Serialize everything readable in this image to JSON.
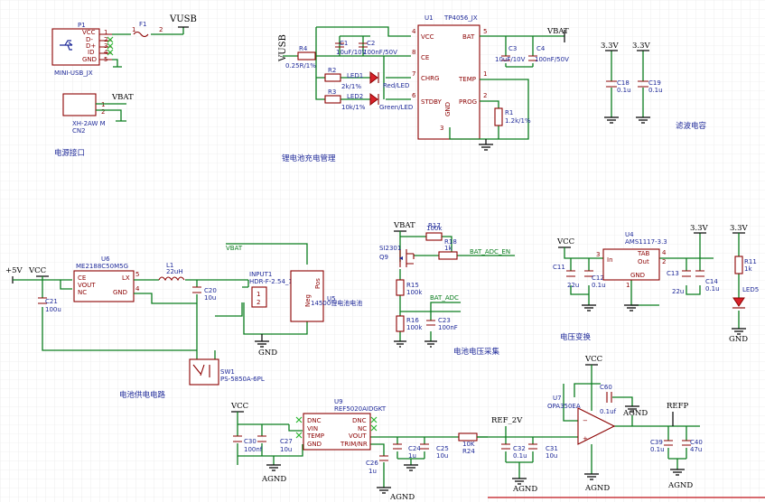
{
  "sections": {
    "power_port": "电源接口",
    "charge": "锂电池充电管理",
    "filter_cap": "滤波电容",
    "battery_supply": "电池供电电路",
    "battery_voltage_sample": "电池电压采集",
    "voltage_convert": "电压变换"
  },
  "nets": {
    "vusb": "VUSB",
    "vbat": "VBAT",
    "v33": "3.3V",
    "v5": "+5V",
    "vcc": "VCC",
    "gnd": "GND",
    "agnd": "AGND",
    "ref2v": "REF_2V",
    "refp": "REFP",
    "bat_adc_en": "BAT_ADC_EN",
    "bat_adc": "BAT_ADC"
  },
  "usb": {
    "ref": "P1",
    "part": "MINI-USB_JX",
    "pins": [
      "VCC",
      "D-",
      "D+",
      "ID",
      "GND"
    ],
    "pin_nums": [
      "1",
      "2",
      "3",
      "4",
      "5"
    ]
  },
  "fuse": {
    "ref": "F1",
    "pin1": "1",
    "pin2": "2"
  },
  "cn2": {
    "ref": "CN2",
    "part": "XH-2AW M",
    "pin1": "1",
    "pin2": "2"
  },
  "tp4056": {
    "ref": "U1",
    "part": "TP4056_JX",
    "left_pins": [
      {
        "num": "4",
        "name": "VCC"
      },
      {
        "num": "8",
        "name": "CE"
      },
      {
        "num": "7",
        "name": "CHRG"
      },
      {
        "num": "6",
        "name": "STDBY"
      }
    ],
    "right_pins": [
      {
        "num": "5",
        "name": "BAT"
      },
      {
        "num": "1",
        "name": "TEMP"
      },
      {
        "num": "2",
        "name": "PROG"
      }
    ],
    "gnd_pin": "GND",
    "gnd_num": "3"
  },
  "r4": {
    "ref": "R4",
    "value": "0.25R/1%"
  },
  "c1": {
    "ref": "C1",
    "value": "10uF/10V"
  },
  "c2": {
    "ref": "C2",
    "value": "100nF/50V"
  },
  "r2": {
    "ref": "R2",
    "value": "2k/1%"
  },
  "r3": {
    "ref": "R3",
    "value": "10k/1%"
  },
  "led1": {
    "ref": "LED1",
    "value": "Red/LED"
  },
  "led2": {
    "ref": "LED2",
    "value": "Green/LED"
  },
  "c3": {
    "ref": "C3",
    "value": "10uF/10V"
  },
  "c4": {
    "ref": "C4",
    "value": "100nF/50V"
  },
  "r1": {
    "ref": "R1",
    "value": "1.2k/1%"
  },
  "c18": {
    "ref": "C18",
    "value": "0.1u"
  },
  "c19": {
    "ref": "C19",
    "value": "0.1u"
  },
  "u6": {
    "ref": "U6",
    "part": "ME2188C50M5G",
    "left_pins": [
      "CE",
      "VOUT",
      "NC"
    ],
    "right_pins": [
      "LX",
      "GND"
    ],
    "nums": [
      "1",
      "2",
      "3",
      "5",
      "4"
    ]
  },
  "l1": {
    "ref": "L1",
    "value": "22uH"
  },
  "c20": {
    "ref": "C20",
    "value": "10u"
  },
  "c21": {
    "ref": "C21",
    "value": "100u"
  },
  "input1": {
    "ref": "INPUT1",
    "part": "HDR-F-2.54_1x2",
    "pin1": "1",
    "pin2": "2"
  },
  "u5": {
    "ref": "U5",
    "part": "14500锂电池电池",
    "pos": "Pos",
    "neg": "Neg"
  },
  "sw1": {
    "ref": "SW1",
    "part": "PS-5850A-6PL"
  },
  "r17": {
    "ref": "R17",
    "value": "100k"
  },
  "r18": {
    "ref": "R18",
    "value": "1k"
  },
  "q9": {
    "ref": "Q9",
    "part": "SI2301"
  },
  "r15": {
    "ref": "R15",
    "value": "100k"
  },
  "r16": {
    "ref": "R16",
    "value": "100k"
  },
  "c23": {
    "ref": "C23",
    "value": "100nF"
  },
  "u4": {
    "ref": "U4",
    "part": "AMS1117-3.3",
    "in": "In",
    "tab": "TAB",
    "out": "Out",
    "gnd": "GND",
    "nums": [
      "3",
      "4",
      "2",
      "1"
    ]
  },
  "c11": {
    "ref": "C11",
    "value": "22u"
  },
  "c12": {
    "ref": "C12",
    "value": "0.1u"
  },
  "c13": {
    "ref": "C13",
    "value": "22u"
  },
  "c14": {
    "ref": "C14",
    "value": "0.1u"
  },
  "r11": {
    "ref": "R11",
    "value": "1k"
  },
  "led5": {
    "ref": "LED5"
  },
  "u9": {
    "ref": "U9",
    "part": "REF5020AIDGKT",
    "left_pins": [
      "DNC",
      "VIN",
      "TEMP",
      "GND"
    ],
    "right_pins": [
      "DNC",
      "NC",
      "VOUT",
      "TRIM/NR"
    ]
  },
  "c30": {
    "ref": "C30",
    "value": "100nf"
  },
  "c27": {
    "ref": "C27",
    "value": "10u"
  },
  "c24": {
    "ref": "C24",
    "value": "1u"
  },
  "c25": {
    "ref": "C25",
    "value": "10u"
  },
  "c26": {
    "ref": "C26",
    "value": "1u"
  },
  "r24": {
    "ref": "R24",
    "value": "10K"
  },
  "c32": {
    "ref": "C32",
    "value": "0.1u"
  },
  "c31": {
    "ref": "C31",
    "value": "10u"
  },
  "u7": {
    "ref": "U7",
    "part": "OPA350EA"
  },
  "c60": {
    "ref": "C60",
    "value": "0.1uf"
  },
  "c39": {
    "ref": "C39",
    "value": "0.1u"
  },
  "c40": {
    "ref": "C40",
    "value": "47u"
  },
  "colors": {
    "wire": "#0a7d1e",
    "body": "#8b0000",
    "label": "#1f2a99",
    "grid": "#e3e3e3"
  }
}
